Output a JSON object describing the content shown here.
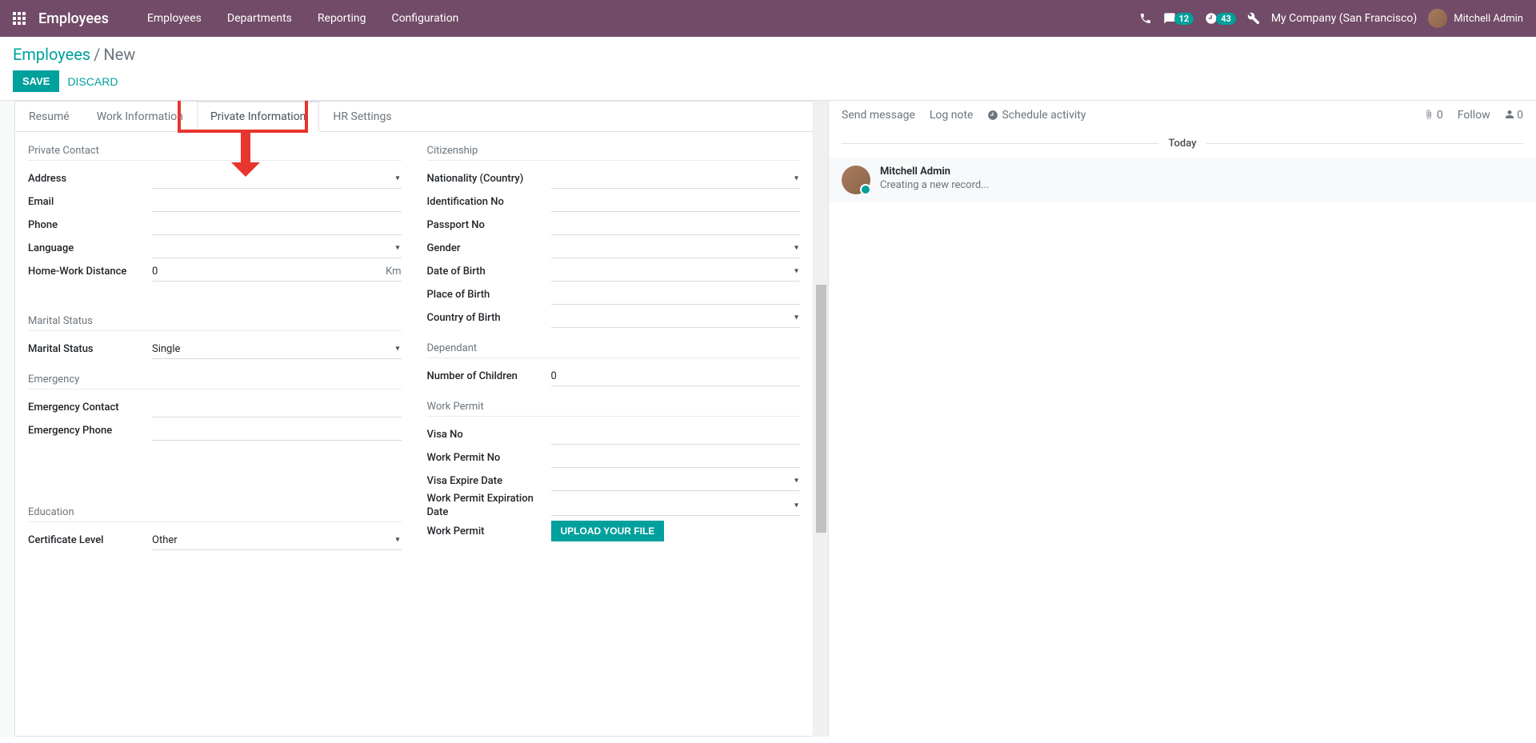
{
  "navbar": {
    "brand": "Employees",
    "menu": [
      "Employees",
      "Departments",
      "Reporting",
      "Configuration"
    ],
    "chat_badge": "12",
    "clock_badge": "43",
    "company": "My Company (San Francisco)",
    "user": "Mitchell Admin"
  },
  "breadcrumb": {
    "root": "Employees",
    "current": "New"
  },
  "buttons": {
    "save": "SAVE",
    "discard": "DISCARD"
  },
  "tabs": [
    "Resumé",
    "Work Information",
    "Private Information",
    "HR Settings"
  ],
  "sections": {
    "left": {
      "private_contact_title": "Private Contact",
      "address_label": "Address",
      "email_label": "Email",
      "phone_label": "Phone",
      "language_label": "Language",
      "home_work_label": "Home-Work Distance",
      "home_work_value": "0",
      "home_work_unit": "Km",
      "marital_title": "Marital Status",
      "marital_label": "Marital Status",
      "marital_value": "Single",
      "emergency_title": "Emergency",
      "emergency_contact_label": "Emergency Contact",
      "emergency_phone_label": "Emergency Phone",
      "education_title": "Education",
      "certificate_label": "Certificate Level",
      "certificate_value": "Other"
    },
    "right": {
      "citizenship_title": "Citizenship",
      "nationality_label": "Nationality (Country)",
      "identification_label": "Identification No",
      "passport_label": "Passport No",
      "gender_label": "Gender",
      "dob_label": "Date of Birth",
      "pob_label": "Place of Birth",
      "cob_label": "Country of Birth",
      "dependant_title": "Dependant",
      "children_label": "Number of Children",
      "children_value": "0",
      "work_permit_title": "Work Permit",
      "visa_label": "Visa No",
      "permit_no_label": "Work Permit No",
      "visa_expire_label": "Visa Expire Date",
      "permit_expire_label": "Work Permit Expiration Date",
      "permit_label": "Work Permit",
      "upload_btn": "UPLOAD YOUR FILE"
    }
  },
  "chatter": {
    "send": "Send message",
    "log": "Log note",
    "schedule": "Schedule activity",
    "attach_count": "0",
    "follow": "Follow",
    "follower_count": "0",
    "today": "Today",
    "message_author": "Mitchell Admin",
    "message_text": "Creating a new record..."
  }
}
